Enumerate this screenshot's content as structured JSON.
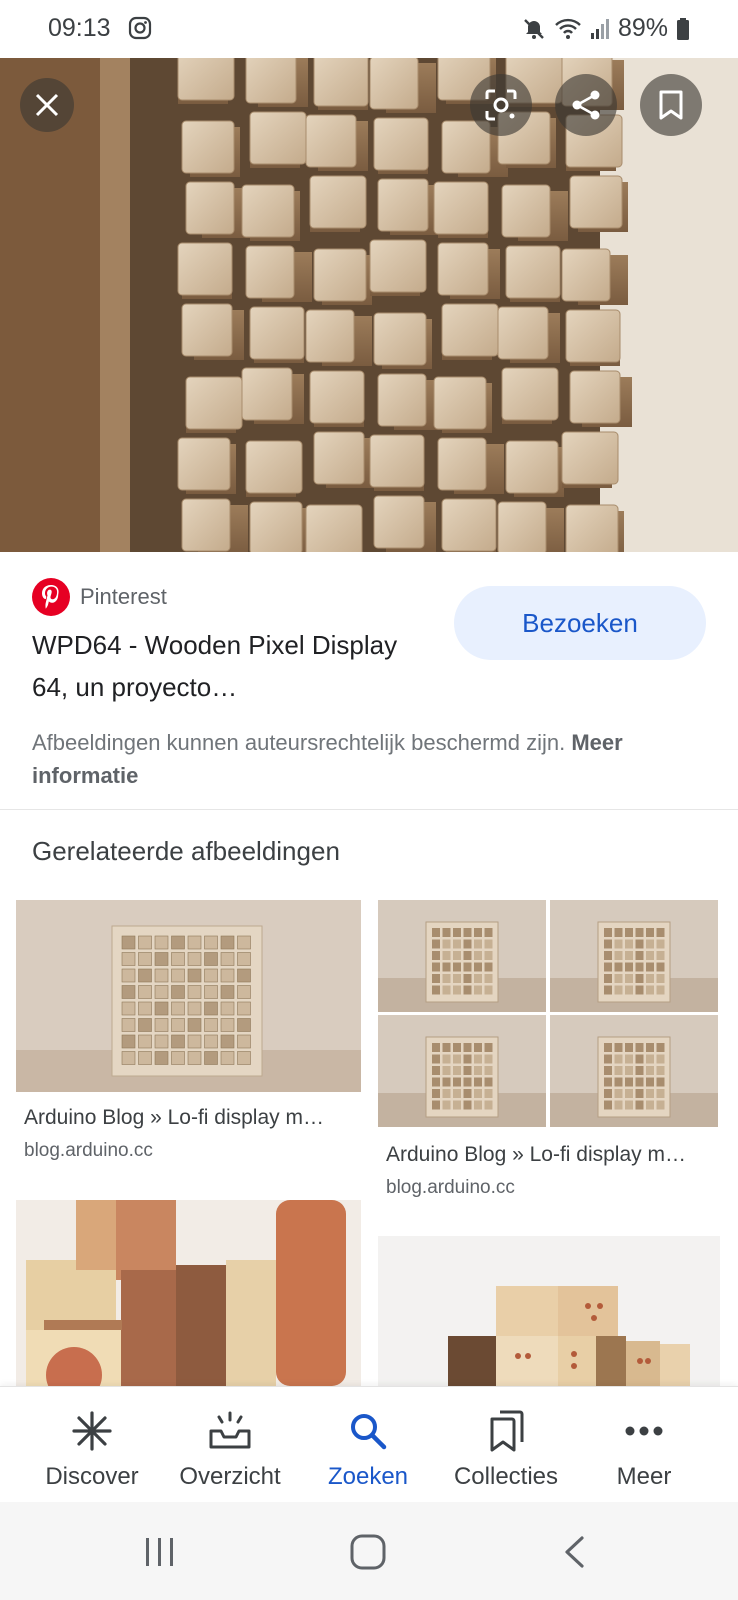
{
  "status_bar": {
    "time": "09:13",
    "battery": "89%",
    "icons": [
      "instagram-icon",
      "mute-icon",
      "wifi-icon",
      "signal-icon",
      "battery-icon"
    ]
  },
  "hero": {
    "buttons": [
      "close-icon",
      "lens-icon",
      "share-icon",
      "bookmark-icon"
    ]
  },
  "result": {
    "source": "Pinterest",
    "title": "WPD64 - Wooden Pixel Display 64, un proyecto…",
    "visit_label": "Bezoeken",
    "copyright_text": "Afbeeldingen kunnen auteursrechtelijk beschermd zijn.",
    "more_info": "Meer informatie"
  },
  "related": {
    "heading": "Gerelateerde afbeeldingen",
    "items": [
      {
        "caption": "Arduino Blog » Lo-fi display m…",
        "domain": "blog.arduino.cc"
      },
      {
        "caption": "Arduino Blog » Lo-fi display m…",
        "domain": "blog.arduino.cc"
      },
      {
        "caption": "",
        "domain": ""
      },
      {
        "caption": "",
        "domain": ""
      }
    ]
  },
  "bottom_nav": {
    "items": [
      {
        "label": "Discover",
        "icon": "asterisk-icon",
        "active": false
      },
      {
        "label": "Overzicht",
        "icon": "inbox-icon",
        "active": false
      },
      {
        "label": "Zoeken",
        "icon": "search-icon",
        "active": true
      },
      {
        "label": "Collecties",
        "icon": "collections-icon",
        "active": false
      },
      {
        "label": "Meer",
        "icon": "more-icon",
        "active": false
      }
    ]
  },
  "colors": {
    "accent": "#1a57c9",
    "visit_bg": "#e8f0fe",
    "pinterest": "#e60023"
  }
}
